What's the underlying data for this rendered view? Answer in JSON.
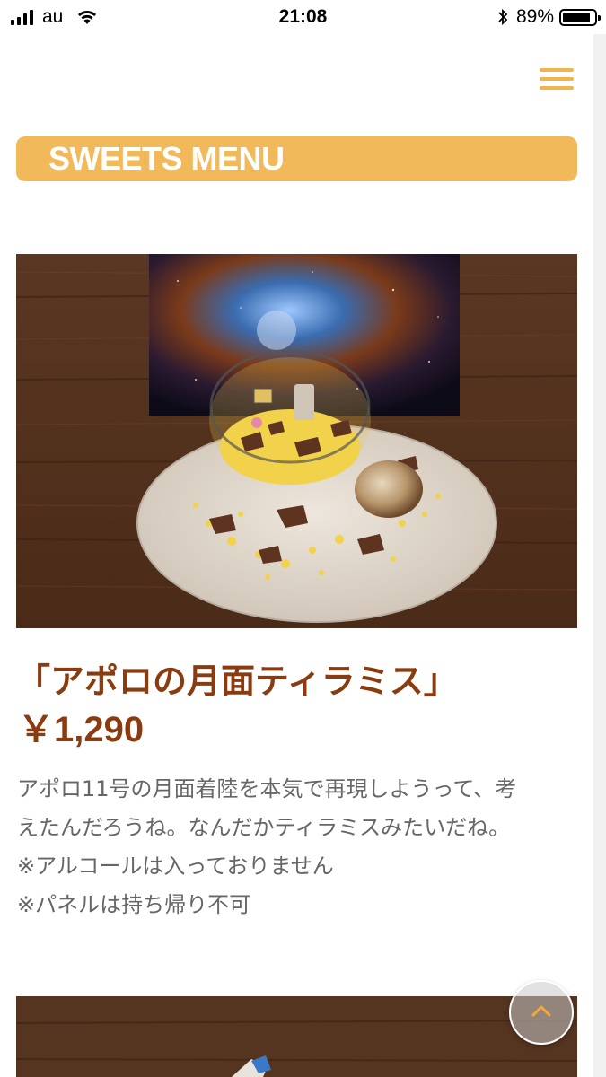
{
  "status_bar": {
    "carrier": "au",
    "time": "21:08",
    "battery": "89%"
  },
  "header": {
    "menu_icon": "hamburger-menu-icon"
  },
  "section": {
    "title": "SWEETS MENU"
  },
  "item": {
    "name": "「アポロの月面ティラミス」",
    "price": "￥1,290",
    "description_lines": [
      "アポロ11号の月面着陸を本気で再現しようって、考",
      "えたんだろうね。なんだかティラミスみたいだね。",
      "※アルコールは入っておりません",
      "※パネルは持ち帰り不可"
    ]
  },
  "colors": {
    "accent": "#f2b95a",
    "item_text": "#8a3c10",
    "body_text": "#666666"
  },
  "scroll_to_top": {
    "icon": "chevron-up-icon"
  }
}
